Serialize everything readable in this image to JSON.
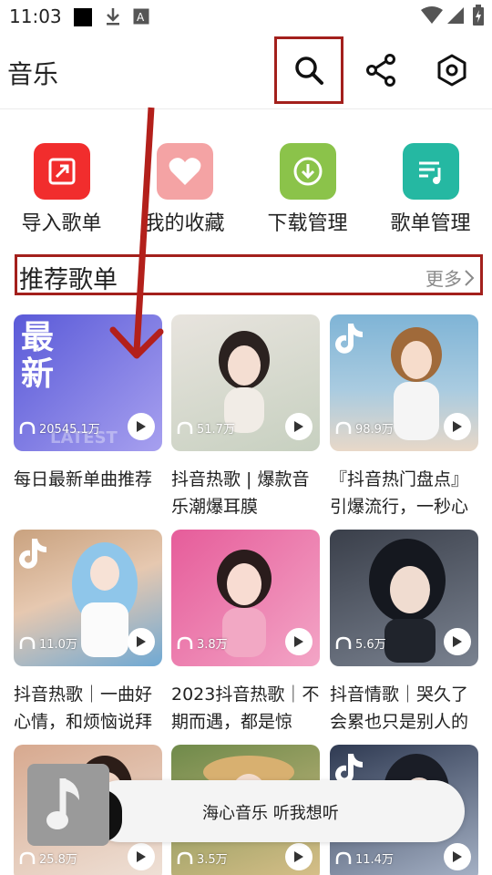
{
  "status_bar": {
    "time": "11:03",
    "icons": [
      "black-square-icon",
      "download-icon",
      "font-a-icon",
      "wifi-icon",
      "signal-icon",
      "battery-charging-icon"
    ]
  },
  "header": {
    "title": "音乐",
    "actions": [
      "search-icon",
      "share-icon",
      "settings-icon"
    ]
  },
  "quick_actions": [
    {
      "label": "导入歌单",
      "color": "#f12d2d",
      "icon": "import-icon"
    },
    {
      "label": "我的收藏",
      "color": "#f4a3a4",
      "icon": "heart-icon"
    },
    {
      "label": "下载管理",
      "color": "#8bc34a",
      "icon": "download-circle-icon"
    },
    {
      "label": "歌单管理",
      "color": "#25b8a2",
      "icon": "playlist-manage-icon"
    }
  ],
  "section": {
    "title": "推荐歌单",
    "more": "更多"
  },
  "playlists": [
    {
      "title": "每日最新单曲推荐",
      "plays": "20545.1万",
      "cover_text": "最新",
      "cover_sub": "LATEST",
      "c1": "#5a5ad8",
      "c2": "#a7a0ef"
    },
    {
      "title": "抖音热歌 | 爆款音乐潮爆耳膜",
      "plays": "51.7万",
      "c1": "#e8e4de",
      "c2": "#c7d0c0"
    },
    {
      "title": "『抖音热门盘点』引爆流行，一秒心",
      "plays": "98.9万",
      "c1": "#7fb4d6",
      "c2": "#e8d8c8"
    },
    {
      "title": "抖音热歌｜一曲好心情，和烦恼说拜",
      "plays": "11.0万",
      "c1": "#c9a27f",
      "c2": "#6fa9d4"
    },
    {
      "title": "2023抖音热歌｜不期而遇，都是惊",
      "plays": "3.8万",
      "c1": "#e65c9a",
      "c2": "#f3a5c6"
    },
    {
      "title": "抖音情歌｜哭久了会累也只是别人的",
      "plays": "5.6万",
      "c1": "#3a3f4a",
      "c2": "#7a8290"
    },
    {
      "title": "",
      "plays": "25.8万",
      "c1": "#d7a98f",
      "c2": "#efe2d8"
    },
    {
      "title": "",
      "plays": "3.5万",
      "c1": "#6f8a4a",
      "c2": "#d9c08a"
    },
    {
      "title": "",
      "plays": "11.4万",
      "c1": "#2f3a52",
      "c2": "#a8b4c8"
    }
  ],
  "mini_player": {
    "text": "海心音乐 听我想听"
  }
}
